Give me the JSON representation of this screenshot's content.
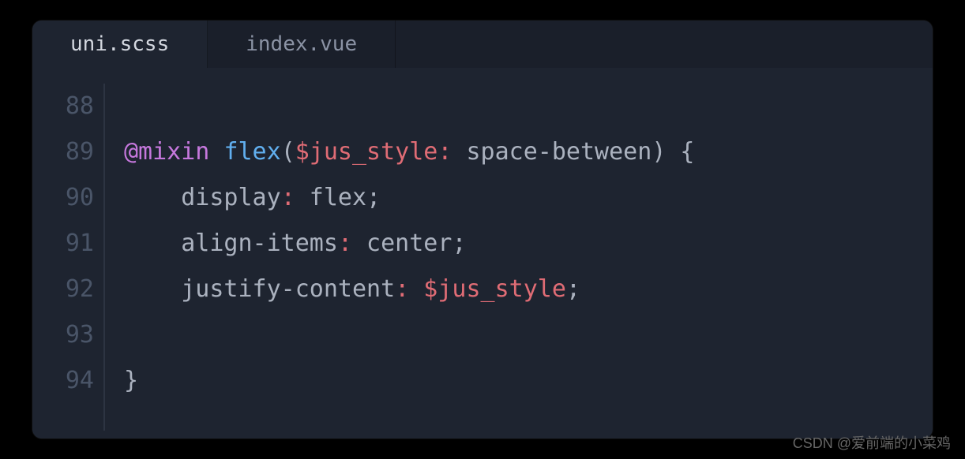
{
  "tabs": [
    {
      "label": "uni.scss",
      "active": true
    },
    {
      "label": "index.vue",
      "active": false
    }
  ],
  "gutter": {
    "lines": [
      "88",
      "89",
      "90",
      "91",
      "92",
      "93",
      "94"
    ]
  },
  "code": {
    "line88": "",
    "line89": {
      "keyword": "@mixin",
      "function": "flex",
      "paren_open": "(",
      "variable": "$jus_style",
      "colon": ":",
      "default_value": " space-between",
      "paren_close": ")",
      "brace_open": " {"
    },
    "line90": {
      "indent": "    ",
      "property": "display",
      "colon": ":",
      "value": " flex",
      "semi": ";"
    },
    "line91": {
      "indent": "    ",
      "property": "align-items",
      "colon": ":",
      "value": " center",
      "semi": ";"
    },
    "line92": {
      "indent": "    ",
      "property": "justify-content",
      "colon": ":",
      "variable": " $jus_style",
      "semi": ";"
    },
    "line93": "",
    "line94": {
      "brace_close": "}"
    }
  },
  "watermark": "CSDN @爱前端的小菜鸡"
}
